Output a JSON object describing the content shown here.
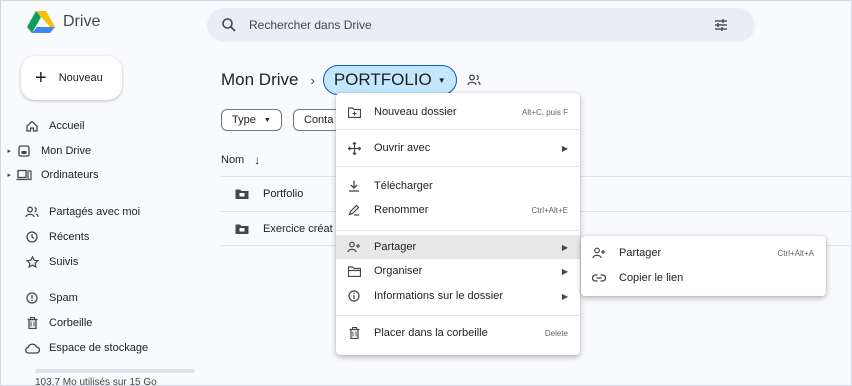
{
  "app": {
    "title": "Drive"
  },
  "search": {
    "placeholder": "Rechercher dans Drive"
  },
  "sidebar": {
    "new_label": "Nouveau",
    "items": [
      {
        "label": "Accueil",
        "icon": "home-icon"
      },
      {
        "label": "Mon Drive",
        "icon": "my-drive-icon"
      },
      {
        "label": "Ordinateurs",
        "icon": "computers-icon"
      },
      {
        "label": "Partagés avec moi",
        "icon": "shared-icon"
      },
      {
        "label": "Récents",
        "icon": "clock-icon"
      },
      {
        "label": "Suivis",
        "icon": "star-icon"
      },
      {
        "label": "Spam",
        "icon": "spam-icon"
      },
      {
        "label": "Corbeille",
        "icon": "trash-icon"
      },
      {
        "label": "Espace de stockage",
        "icon": "cloud-icon"
      }
    ],
    "storage_text": "103,7 Mo utilisés sur 15 Go",
    "storage_fraction": 0.007
  },
  "breadcrumb": {
    "root": "Mon Drive",
    "folder": "PORTFOLIO"
  },
  "filters": {
    "type_label": "Type",
    "contacts_label": "Conta"
  },
  "table": {
    "name_header": "Nom",
    "rows": [
      {
        "name": "Portfolio"
      },
      {
        "name": "Exercice créat"
      }
    ]
  },
  "context_menu": {
    "items": [
      {
        "label": "Nouveau dossier",
        "shortcut": "Alt+C, puis F"
      },
      {
        "label": "Ouvrir avec"
      },
      {
        "label": "Télécharger"
      },
      {
        "label": "Renommer",
        "shortcut": "Ctrl+Alt+E"
      },
      {
        "label": "Partager"
      },
      {
        "label": "Organiser"
      },
      {
        "label": "Informations sur le dossier"
      },
      {
        "label": "Placer dans la corbeille",
        "shortcut": "Delete"
      }
    ]
  },
  "share_submenu": {
    "items": [
      {
        "label": "Partager",
        "shortcut": "Ctrl+Alt+A"
      },
      {
        "label": "Copier le lien"
      }
    ]
  },
  "colors": {
    "accent": "#0b57d0",
    "pill_bg": "#c2e7ff",
    "search_bg": "#e9eef6"
  }
}
